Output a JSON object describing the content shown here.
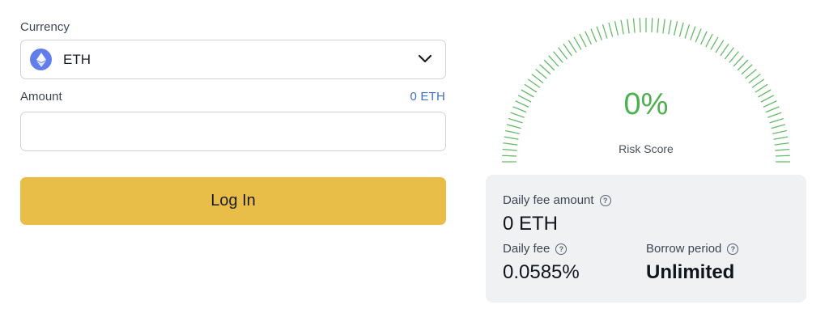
{
  "form": {
    "currency_label": "Currency",
    "currency_value": "ETH",
    "currency_icon": "ethereum-icon",
    "amount_label": "Amount",
    "balance": "0 ETH",
    "amount_value": "",
    "amount_placeholder": "",
    "login_label": "Log In"
  },
  "gauge": {
    "value": "0%",
    "caption": "Risk Score",
    "level": 0
  },
  "card": {
    "daily_fee_amount_label": "Daily fee amount",
    "daily_fee_amount_value": "0 ETH",
    "daily_fee_label": "Daily fee",
    "daily_fee_value": "0.0585%",
    "borrow_period_label": "Borrow period",
    "borrow_period_value": "Unlimited"
  },
  "colors": {
    "accent_button": "#e8bd48",
    "gauge_green": "#4caf50",
    "link_blue": "#3d6fc4",
    "eth_purple": "#627eea"
  }
}
